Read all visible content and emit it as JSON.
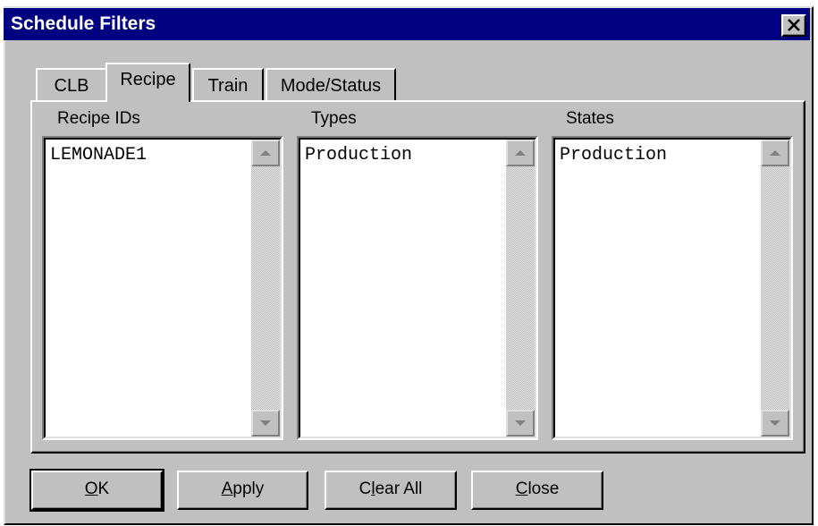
{
  "window": {
    "title": "Schedule Filters",
    "close_icon": "close-icon"
  },
  "tabs": [
    {
      "label": "CLB",
      "active": false
    },
    {
      "label": "Recipe",
      "active": true
    },
    {
      "label": "Train",
      "active": false
    },
    {
      "label": "Mode/Status",
      "active": false
    }
  ],
  "columns": {
    "recipe_ids": {
      "label": "Recipe IDs",
      "items": [
        "LEMONADE1"
      ]
    },
    "types": {
      "label": "Types",
      "items": [
        "Production"
      ]
    },
    "states": {
      "label": "States",
      "items": [
        "Production"
      ]
    }
  },
  "buttons": {
    "ok": {
      "mnemonic": "O",
      "rest": "K"
    },
    "apply": {
      "mnemonic": "A",
      "rest": "pply"
    },
    "clear_all": {
      "pre": "C",
      "mnemonic": "l",
      "rest": "ear All"
    },
    "close": {
      "mnemonic": "C",
      "rest": "lose"
    }
  },
  "colors": {
    "titlebar": "#000080",
    "face": "#c0c0c0"
  }
}
